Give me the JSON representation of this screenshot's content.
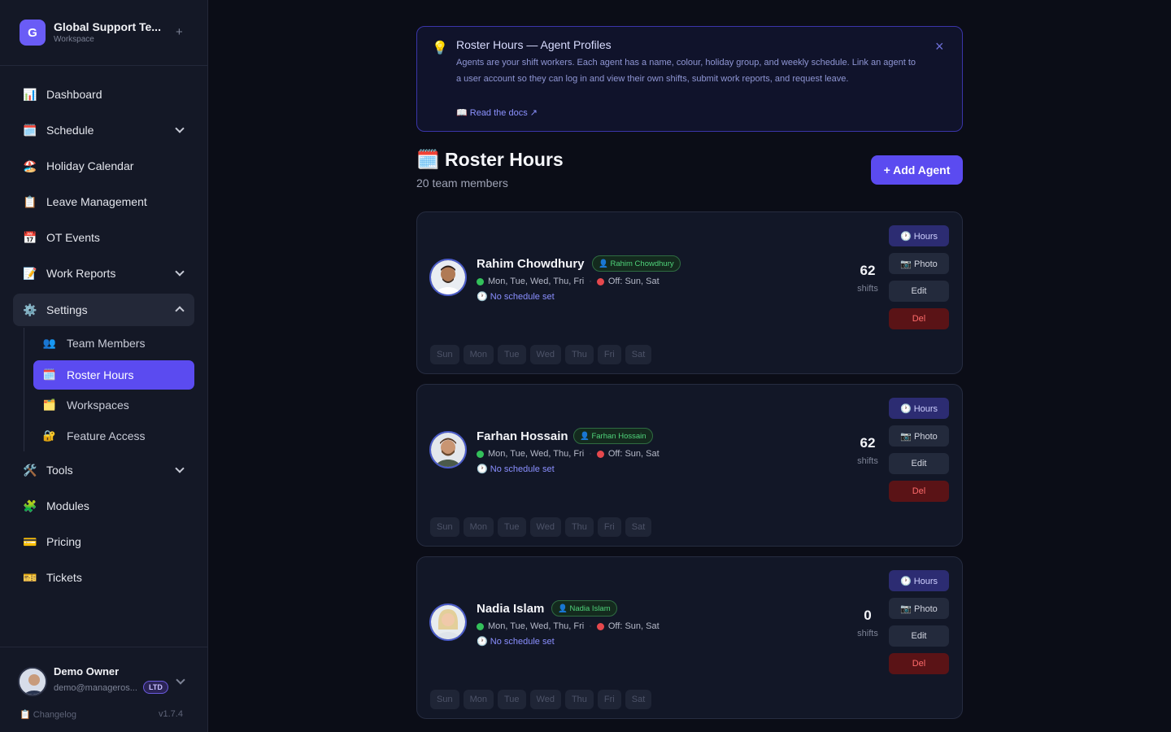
{
  "workspace": {
    "logo_letter": "G",
    "name": "Global Support Te...",
    "subtitle": "Workspace",
    "add_icon": "plus-icon"
  },
  "nav": [
    {
      "icon": "📊",
      "icon_name": "chart-icon",
      "label": "Dashboard"
    },
    {
      "icon": "🗓️",
      "icon_name": "calendar-icon",
      "label": "Schedule",
      "expandable": true
    },
    {
      "icon": "🏖️",
      "icon_name": "beach-icon",
      "label": "Holiday Calendar"
    },
    {
      "icon": "📋",
      "icon_name": "clipboard-icon",
      "label": "Leave Management"
    },
    {
      "icon": "📅",
      "icon_name": "date-icon",
      "label": "OT Events"
    },
    {
      "icon": "📝",
      "icon_name": "memo-icon",
      "label": "Work Reports",
      "expandable": true
    },
    {
      "icon": "⚙️",
      "icon_name": "gear-icon",
      "label": "Settings",
      "expanded": true
    },
    {
      "icon": "🛠️",
      "icon_name": "tools-icon",
      "label": "Tools",
      "expandable": true
    },
    {
      "icon": "🧩",
      "icon_name": "puzzle-icon",
      "label": "Modules"
    },
    {
      "icon": "💳",
      "icon_name": "card-icon",
      "label": "Pricing"
    },
    {
      "icon": "🎫",
      "icon_name": "ticket-icon",
      "label": "Tickets"
    }
  ],
  "settings_sub": [
    {
      "icon": "👥",
      "icon_name": "users-icon",
      "label": "Team Members"
    },
    {
      "icon": "🗓️",
      "icon_name": "calendar-icon",
      "label": "Roster Hours",
      "active": true
    },
    {
      "icon": "🗂️",
      "icon_name": "folder-icon",
      "label": "Workspaces"
    },
    {
      "icon": "🔐",
      "icon_name": "lock-icon",
      "label": "Feature Access"
    }
  ],
  "user": {
    "name": "Demo Owner",
    "email": "demo@manageros...",
    "plan": "LTD",
    "changelog": "📋 Changelog",
    "version": "v1.7.4"
  },
  "info": {
    "icon": "💡",
    "title": "Roster Hours — Agent Profiles",
    "text": "Agents are your shift workers. Each agent has a name, colour, holiday group, and weekly schedule. Link an agent to a user account so they can log in and view their own shifts, submit work reports, and request leave.",
    "link": "📖 Read the docs ↗",
    "close": "×"
  },
  "page": {
    "title": "🗓️ Roster Hours",
    "subtitle": "20 team members",
    "add_button": "+ Add Agent"
  },
  "card_buttons": {
    "hours": "🕐 Hours",
    "photo": "📷 Photo",
    "edit": "Edit",
    "del": "Del"
  },
  "weekdays": [
    "Sun",
    "Mon",
    "Tue",
    "Wed",
    "Thu",
    "Fri",
    "Sat"
  ],
  "agents": [
    {
      "name": "Rahim Chowdhury",
      "badge": "👤 Rahim Chowdhury",
      "work_days": "Mon, Tue, Wed, Thu, Fri",
      "off_days": "Off: Sun, Sat",
      "schedule": "🕐 No schedule set",
      "shifts": "62",
      "shifts_label": "shifts"
    },
    {
      "name": "Farhan Hossain",
      "badge": "👤 Farhan Hossain",
      "work_days": "Mon, Tue, Wed, Thu, Fri",
      "off_days": "Off: Sun, Sat",
      "schedule": "🕐 No schedule set",
      "shifts": "62",
      "shifts_label": "shifts"
    },
    {
      "name": "Nadia Islam",
      "badge": "👤 Nadia Islam",
      "work_days": "Mon, Tue, Wed, Thu, Fri",
      "off_days": "Off: Sun, Sat",
      "schedule": "🕐 No schedule set",
      "shifts": "0",
      "shifts_label": "shifts"
    }
  ]
}
